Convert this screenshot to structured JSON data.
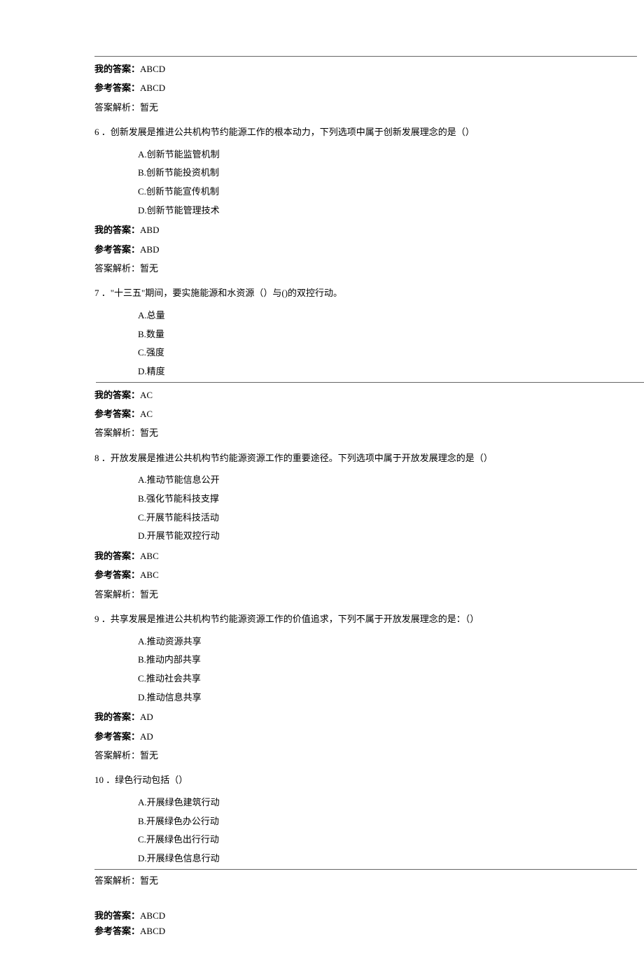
{
  "labels": {
    "my_answer": "我的答案：",
    "ref_answer": "参考答案：",
    "analysis": "答案解析：暂无"
  },
  "top_my_answer": "ABCD",
  "top_ref_answer": "ABCD",
  "questions": [
    {
      "num": "6",
      "text": "．创新发展是推进公共机构节约能源工作的根本动力，下列选项中属于创新发展理念的是（）",
      "options": [
        "A.创新节能监管机制",
        "B.创新节能投资机制",
        "C.创新节能宣传机制",
        "D.创新节能管理技术"
      ],
      "my_answer": "ABD",
      "ref_answer": "ABD"
    },
    {
      "num": "7",
      "text": "．\"十三五\"期间，要实施能源和水资源（）与()的双控行动。",
      "options": [
        "A.总量",
        "B.数量",
        "C.强度",
        "D.精度"
      ],
      "my_answer": "AC",
      "ref_answer": "AC",
      "underline_after_options": true
    },
    {
      "num": "8",
      "text": "．开放发展是推进公共机构节约能源资源工作的重要途径。下列选项中属于开放发展理念的是（）",
      "options": [
        "A.推动节能信息公开",
        "B.强化节能科技支撑",
        "C.开展节能科技活动",
        "D.开展节能双控行动"
      ],
      "my_answer": "ABC",
      "ref_answer": "ABC"
    },
    {
      "num": "9",
      "text": "．共享发展是推进公共机构节约能源资源工作的价值追求，下列不属于开放发展理念的是：（）",
      "options": [
        "A.推动资源共享",
        "B.推动内部共享",
        "C.推动社会共享",
        "D.推动信息共享"
      ],
      "my_answer": "AD",
      "ref_answer": "AD"
    },
    {
      "num": "10",
      "text": "．绿色行动包括（）",
      "options": [
        "A.开展绿色建筑行动",
        "B.开展绿色办公行动",
        "C.开展绿色出行行动",
        "D.开展绿色信息行动"
      ],
      "bottom_rule_after_options": true
    }
  ],
  "post_analysis": "答案解析：暂无",
  "footer": {
    "my_answer": "ABCD",
    "ref_answer": "ABCD"
  }
}
